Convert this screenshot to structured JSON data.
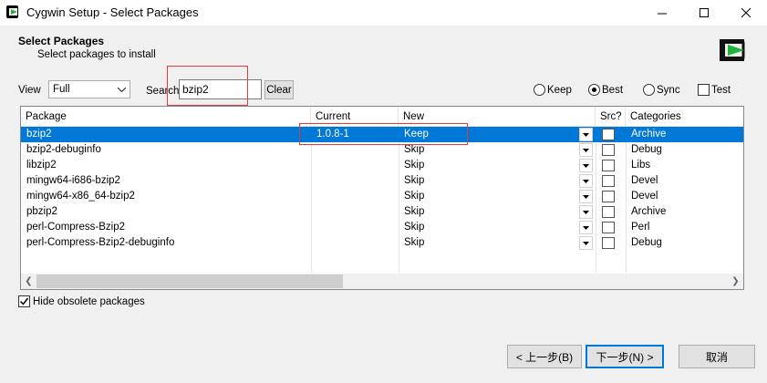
{
  "window": {
    "title": "Cygwin Setup - Select Packages"
  },
  "header": {
    "title": "Select Packages",
    "subtitle": "Select packages to install"
  },
  "filters": {
    "view_label": "View",
    "view_value": "Full",
    "search_label": "Search",
    "search_value": "bzip2",
    "clear_label": "Clear"
  },
  "modes": [
    {
      "label": "Keep",
      "selected": false
    },
    {
      "label": "Best",
      "selected": true
    },
    {
      "label": "Sync",
      "selected": false
    }
  ],
  "test_label": "Test",
  "columns": [
    "Package",
    "Current",
    "New",
    "Src?",
    "Categories"
  ],
  "rows": [
    {
      "package": "bzip2",
      "current": "1.0.8-1",
      "new": "Keep",
      "category": "Archive",
      "selected": true
    },
    {
      "package": "bzip2-debuginfo",
      "current": "",
      "new": "Skip",
      "category": "Debug"
    },
    {
      "package": "libzip2",
      "current": "",
      "new": "Skip",
      "category": "Libs"
    },
    {
      "package": "mingw64-i686-bzip2",
      "current": "",
      "new": "Skip",
      "category": "Devel"
    },
    {
      "package": "mingw64-x86_64-bzip2",
      "current": "",
      "new": "Skip",
      "category": "Devel"
    },
    {
      "package": "pbzip2",
      "current": "",
      "new": "Skip",
      "category": "Archive"
    },
    {
      "package": "perl-Compress-Bzip2",
      "current": "",
      "new": "Skip",
      "category": "Perl"
    },
    {
      "package": "perl-Compress-Bzip2-debuginfo",
      "current": "",
      "new": "Skip",
      "category": "Debug"
    }
  ],
  "hide_obsolete": {
    "label": "Hide obsolete packages",
    "checked": true
  },
  "buttons": {
    "back": "< 上一步(B)",
    "next": "下一步(N) >",
    "cancel": "取消"
  },
  "colors": {
    "selection": "#0078d7",
    "annotation": "#e03c3c"
  }
}
